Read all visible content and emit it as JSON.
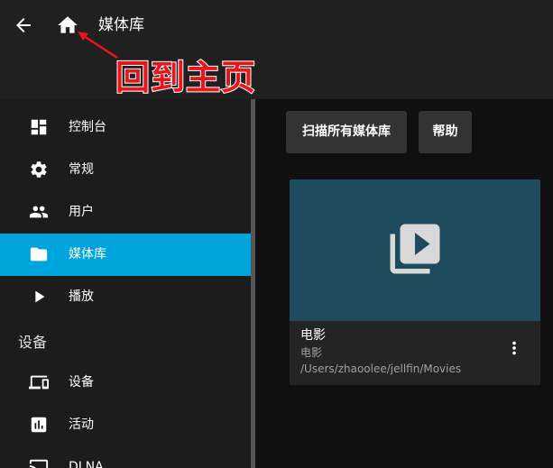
{
  "header": {
    "title": "媒体库",
    "back_icon": "arrow-back-icon",
    "home_icon": "home-icon"
  },
  "annotation": {
    "text": "回到主页",
    "color": "#e8161a"
  },
  "sidebar": {
    "items": [
      {
        "label": "控制台",
        "icon": "dashboard-icon",
        "active": false
      },
      {
        "label": "常规",
        "icon": "gear-icon",
        "active": false
      },
      {
        "label": "用户",
        "icon": "people-icon",
        "active": false
      },
      {
        "label": "媒体库",
        "icon": "folder-icon",
        "active": true
      },
      {
        "label": "播放",
        "icon": "play-icon",
        "active": false
      }
    ],
    "section_devices": "设备",
    "device_items": [
      {
        "label": "设备",
        "icon": "devices-icon"
      },
      {
        "label": "活动",
        "icon": "activity-chart-icon"
      },
      {
        "label": "DLNA",
        "icon": "dlna-icon"
      }
    ]
  },
  "main": {
    "scan_button": "扫描所有媒体库",
    "help_button": "帮助",
    "library_card": {
      "title": "电影",
      "type": "电影",
      "path": "/Users/zhaoolee/jellfin/Movies"
    }
  },
  "colors": {
    "accent": "#00a4dc",
    "header_bg": "#202020",
    "sidebar_bg": "#1c1c1c",
    "card_image_bg": "#1d4a5c"
  }
}
